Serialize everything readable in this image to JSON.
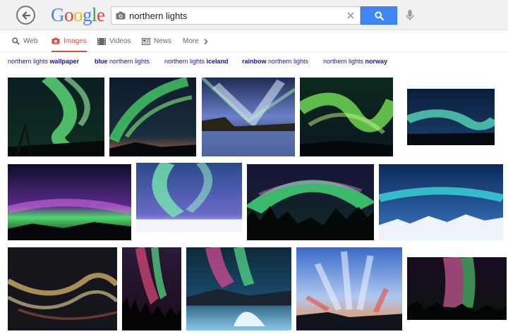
{
  "search": {
    "query": "northern lights"
  },
  "logo": {
    "letters": [
      "G",
      "o",
      "o",
      "g",
      "l",
      "e"
    ],
    "colors": [
      "#4285f4",
      "#ea4335",
      "#fbbc05",
      "#4285f4",
      "#34a853",
      "#ea4335"
    ]
  },
  "tabs": {
    "web": "Web",
    "images": "Images",
    "videos": "Videos",
    "news": "News",
    "more": "More"
  },
  "related": [
    {
      "prefix": "northern lights ",
      "bold": "wallpaper",
      "suffix": ""
    },
    {
      "prefix": "",
      "bold": "blue",
      "suffix": " northern lights"
    },
    {
      "prefix": "northern lights ",
      "bold": "iceland",
      "suffix": ""
    },
    {
      "prefix": "",
      "bold": "rainbow",
      "suffix": " northern lights"
    },
    {
      "prefix": "northern lights ",
      "bold": "norway",
      "suffix": ""
    }
  ],
  "icons": {
    "back": "back-arrow-icon",
    "camera": "camera-icon",
    "clear": "close-icon",
    "search": "magnifier-icon",
    "mic": "microphone-icon"
  },
  "colors": {
    "accent_red": "#dd4b39",
    "search_blue": "#4285f4",
    "link_blue": "#1a0dab"
  }
}
